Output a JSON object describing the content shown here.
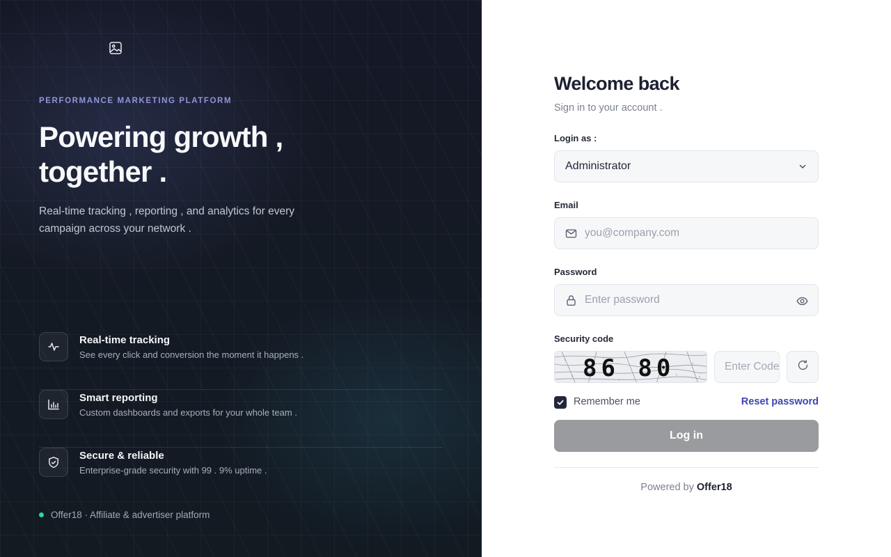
{
  "left": {
    "logo_icon": "image-icon",
    "eyebrow": "PERFORMANCE MARKETING PLATFORM",
    "hero_line1": "Powering growth ,",
    "hero_line2": "together .",
    "subtitle": "Real-time tracking , reporting , and analytics for every campaign across your network .",
    "features": [
      {
        "icon": "activity-icon",
        "title": "Real-time tracking",
        "desc": "See every click and conversion the moment it happens ."
      },
      {
        "icon": "bar-chart-icon",
        "title": "Smart reporting",
        "desc": "Custom dashboards and exports for your whole team ."
      },
      {
        "icon": "shield-check-icon",
        "title": "Secure & reliable",
        "desc": "Enterprise-grade security with 99 . 9% uptime ."
      }
    ],
    "footer": "Offer18 · Affiliate & advertiser platform",
    "status_color": "#34d399"
  },
  "form": {
    "title": "Welcome back",
    "subtitle": "Sign in to your account .",
    "login_as_label": "Login as :",
    "login_as_value": "Administrator",
    "email_label": "Email",
    "email_placeholder": "you@company.com",
    "password_label": "Password",
    "password_placeholder": "Enter password",
    "security_label": "Security code",
    "captcha_text": "86 80",
    "code_placeholder": "Enter Code",
    "remember_label": "Remember me",
    "remember_checked": true,
    "reset_label": "Reset password",
    "login_button": "Log in",
    "powered_prefix": "Powered by",
    "powered_brand": "Offer18"
  },
  "colors": {
    "accent": "#3e46b0",
    "button_disabled": "#9a9b9e",
    "eyebrow": "#8e95d8"
  }
}
